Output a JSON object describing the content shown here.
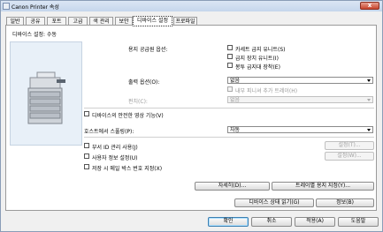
{
  "window": {
    "title": "Canon Printer 속성",
    "close_label": "x"
  },
  "tabs": [
    {
      "label": "일반"
    },
    {
      "label": "공유"
    },
    {
      "label": "포트"
    },
    {
      "label": "고급"
    },
    {
      "label": "색 관리"
    },
    {
      "label": "보안"
    },
    {
      "label": "디바이스 설정"
    },
    {
      "label": "프로파일"
    }
  ],
  "panel": {
    "heading": "디바이스 설정: 수동",
    "paper_source": {
      "label": "용지 공급원 옵션:",
      "options": [
        {
          "label": "카세트 급지 유니트(S)"
        },
        {
          "label": "급지 장치 유니트(I)"
        },
        {
          "label": "봉투 급지대 장착(E)"
        }
      ]
    },
    "output": {
      "label": "출력 옵션(O):",
      "value": "없음",
      "inner_finisher": "내부 피니셔 추가 트레이(H)"
    },
    "punch": {
      "label": "펀치(C):",
      "value": "없음"
    },
    "secure_erase": "디바이스의 안전한 영상 기능(V)",
    "host_spooling": {
      "label": "호스트에서 스풀링(P):",
      "value": "자동"
    },
    "dept_id": {
      "label": "부서 ID 관리 사용(J)",
      "settings_btn": "설정(T)..."
    },
    "user_info": {
      "label": "사용자 정보 설정(U)",
      "settings_btn": "설정(W)..."
    },
    "mailbox": "저장 시 메일 박스 번호 지정(X)",
    "details_btn": "자세히(D)...",
    "tray_paper_btn": "트레이별 용지 지정(Y)...",
    "get_status_btn": "디바이스 상태 읽기(G)",
    "about_btn": "정보(B)"
  },
  "footer": {
    "ok": "확인",
    "cancel": "취소",
    "apply": "적용(A)",
    "help": "도움말"
  },
  "colors": {
    "accent": "#3c7fb1",
    "titlebar": "#c5d6ec",
    "close": "#c8432a"
  }
}
